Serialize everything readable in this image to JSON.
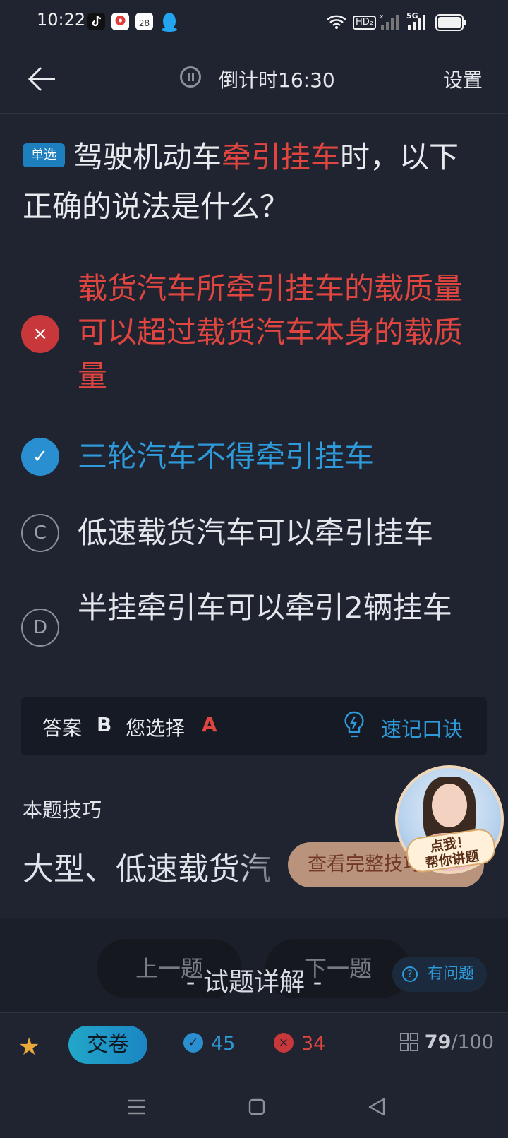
{
  "status_bar": {
    "time": "10:22",
    "app_icons": [
      "tiktok-icon",
      "map-pin-app-icon",
      "calendar-app-icon",
      "qq-penguin-icon"
    ],
    "calendar_day": "28",
    "hd_label": "HD₂",
    "network_label": "5G"
  },
  "header": {
    "back_icon": "arrow-left-icon",
    "pause_icon": "pause-icon",
    "countdown": "倒计时16:30",
    "settings_label": "设置"
  },
  "question": {
    "type_tag": "单选",
    "text_before": "驾驶机动车",
    "text_highlight": "牵引挂车",
    "text_after": "时，以下正确的说法是什么？"
  },
  "options": [
    {
      "key": "A",
      "marker": "×",
      "state": "wrong",
      "text": "载货汽车所牵引挂车的载质量可以超过载货汽车本身的载质量"
    },
    {
      "key": "B",
      "marker": "✓",
      "state": "correct",
      "text": "三轮汽车不得牵引挂车"
    },
    {
      "key": "C",
      "marker": "C",
      "state": "plain",
      "text": "低速载货汽车可以牵引挂车"
    },
    {
      "key": "D",
      "marker": "D",
      "state": "plain",
      "text": "半挂牵引车可以牵引2辆挂车"
    }
  ],
  "answer_bar": {
    "answer_label": "答案",
    "answer_value": "B",
    "chosen_label": "您选择",
    "chosen_value": "A",
    "memo_label": "速记口诀",
    "memo_icon": "lightbulb-icon"
  },
  "tip": {
    "title": "本题技巧",
    "preview": "大型、低速载货汽",
    "full_button": "查看完整技巧",
    "helper_line1": "点我！",
    "helper_line2": "帮你讲题"
  },
  "bottom_sheet": {
    "prev_label": "上一题",
    "next_label": "下一题",
    "detail_title": "- 试题详解 -",
    "ask_label": "有问题"
  },
  "bottom_bar": {
    "star_icon": "star-icon",
    "submit_label": "交卷",
    "correct_count": "45",
    "wrong_count": "34",
    "current": "79",
    "total": "/100"
  },
  "colors": {
    "background": "#1f2430",
    "accent_blue": "#2f9ad9",
    "wrong_red": "#e0463f",
    "star_gold": "#e8a93a"
  }
}
